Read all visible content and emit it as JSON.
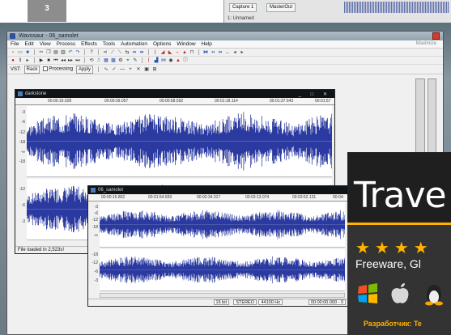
{
  "badge": "3",
  "background_window": {
    "buttons": [
      "Capture 1",
      "MasterOut"
    ],
    "track_label": "1: Unnamed"
  },
  "app": {
    "title": "Wavosaur - 06_samolet",
    "menu": [
      "File",
      "Edit",
      "View",
      "Process",
      "Effects",
      "Tools",
      "Automation",
      "Options",
      "Window",
      "Help"
    ],
    "mdi_label": "Maximize",
    "vst_row": {
      "vst_label": "VST:",
      "rack_button": "Rack",
      "processing_label": "Processing",
      "apply_button": "Apply"
    }
  },
  "window_back": {
    "title": "darkstone",
    "ruler": [
      "00:00:19.028",
      "00:00:39.057",
      "00:00:58.592",
      "00:01:18.114",
      "00:01:37.643",
      "00:01:57"
    ],
    "db_labels": [
      "-3",
      "-6",
      "-12",
      "-18",
      "-∞",
      "-18",
      "-12",
      "-6",
      "-3"
    ],
    "status": "File loaded in 2,523s!"
  },
  "window_front": {
    "title": "06_samolet",
    "ruler": [
      "00:00:15.802",
      "00:01:54.659",
      "00:02:34.017",
      "00:03:13.074",
      "00:03:52.131",
      "00:04:"
    ],
    "db_labels": [
      "-3",
      "-6",
      "-12",
      "-18",
      "-∞",
      "-18",
      "-12",
      "-6",
      "-3"
    ],
    "status_fields": [
      "16 bit",
      "STEREO",
      "44100 Hz",
      "00:00:00.000 - 0"
    ]
  },
  "overlay": {
    "title": "Trave",
    "stars": "★★★★",
    "license": "Freeware, Gl",
    "developer": "Разработчик: Te"
  },
  "colors": {
    "waveform": "#2b3aa0",
    "accent_star": "#ffb200",
    "overlay_bg": "#1f1f1f"
  }
}
